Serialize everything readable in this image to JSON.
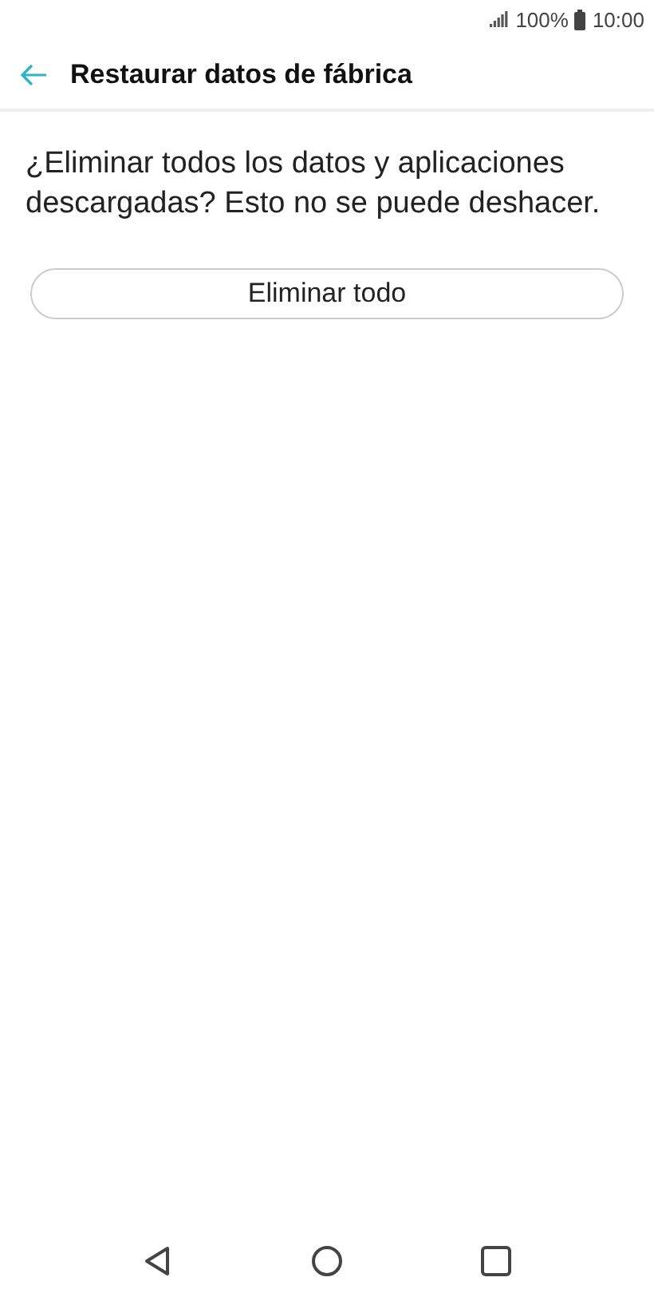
{
  "status_bar": {
    "battery": "100%",
    "time": "10:00"
  },
  "header": {
    "title": "Restaurar datos de fábrica"
  },
  "message": "¿Eliminar todos los datos y aplicaciones descargadas? Esto no se puede deshacer.",
  "button": {
    "label": "Eliminar todo"
  }
}
